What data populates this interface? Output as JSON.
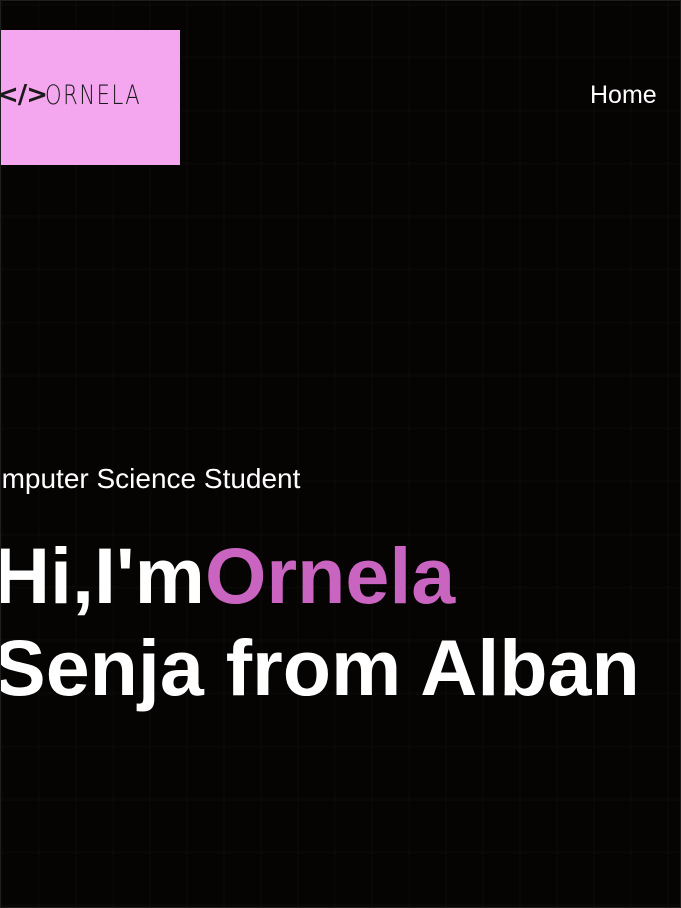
{
  "header": {
    "logo": {
      "code_symbol": "</>",
      "name": "ORNELA",
      "background_color": "#f4a6ee"
    },
    "nav": [
      {
        "label": "Home"
      }
    ]
  },
  "hero": {
    "subtitle": "omputer Science Student",
    "greeting": "Hi,I'm",
    "first_name": "Ornela",
    "line2": "Senja from Alban",
    "accent_color": "#c965c1"
  }
}
